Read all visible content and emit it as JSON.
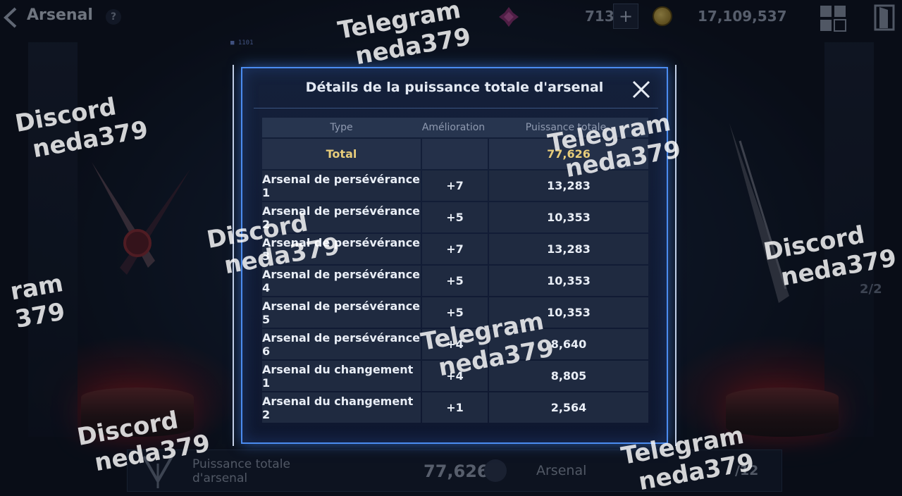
{
  "topbar": {
    "title": "Arsenal",
    "help": "?",
    "gem_count": "713",
    "plus": "+",
    "coin_count": "17,109,537",
    "hud_tag": "1101",
    "side_count": "2/2"
  },
  "modal": {
    "title": "Détails de la puissance totale d'arsenal",
    "columns": [
      "Type",
      "Amélioration",
      "Puissance totale"
    ],
    "total": {
      "type": "Total",
      "level": "",
      "power": "77,626"
    },
    "rows": [
      {
        "type": "Arsenal de persévérance 1",
        "level": "+7",
        "power": "13,283"
      },
      {
        "type": "Arsenal de persévérance 2",
        "level": "+5",
        "power": "10,353"
      },
      {
        "type": "Arsenal de persévérance 3",
        "level": "+7",
        "power": "13,283"
      },
      {
        "type": "Arsenal de persévérance 4",
        "level": "+5",
        "power": "10,353"
      },
      {
        "type": "Arsenal de persévérance 5",
        "level": "+5",
        "power": "10,353"
      },
      {
        "type": "Arsenal de persévérance 6",
        "level": "+4",
        "power": "8,640"
      },
      {
        "type": "Arsenal du changement 1",
        "level": "+4",
        "power": "8,805"
      },
      {
        "type": "Arsenal du changement 2",
        "level": "+1",
        "power": "2,564"
      }
    ]
  },
  "bottombar": {
    "label": "Puissance totale d'arsenal",
    "value": "77,626",
    "tab": "Arsenal",
    "page": "/12"
  },
  "watermarks": [
    {
      "line1": "Telegram",
      "line2": "neda379"
    },
    {
      "line1": "Discord",
      "line2": "neda379"
    },
    {
      "line1": "Telegram",
      "line2": "neda379"
    },
    {
      "line1": "Discord",
      "line2": "neda379"
    },
    {
      "line1": "ram",
      "line2": "379"
    },
    {
      "line1": "Discord",
      "line2": "neda379"
    },
    {
      "line1": "Telegram",
      "line2": "neda379"
    },
    {
      "line1": "Discord",
      "line2": "neda379"
    },
    {
      "line1": "Telegram",
      "line2": "neda379"
    }
  ]
}
